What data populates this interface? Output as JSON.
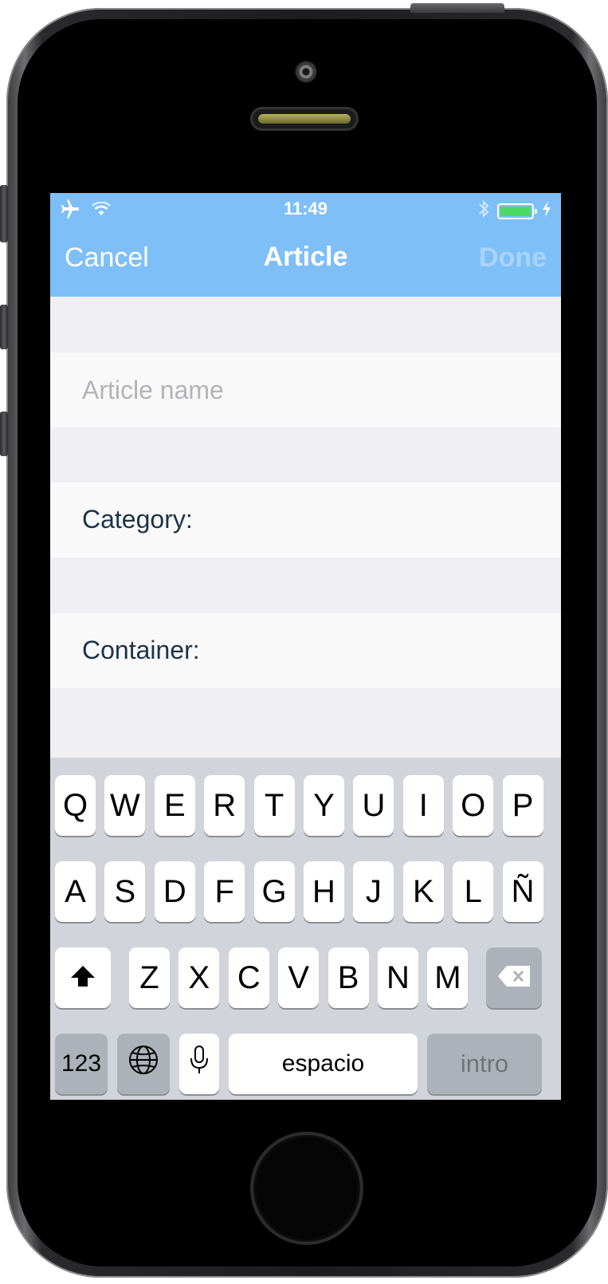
{
  "status_bar": {
    "time": "11:49",
    "battery_color": "#4cd964",
    "left_icons": [
      "airplane-icon",
      "wifi-icon"
    ],
    "right_icons": [
      "bluetooth-icon",
      "battery-icon",
      "charging-bolt-icon"
    ]
  },
  "nav": {
    "cancel_label": "Cancel",
    "title": "Article",
    "done_label": "Done",
    "bar_color": "#7fbff8"
  },
  "form": {
    "name_placeholder": "Article name",
    "name_value": "",
    "category_label": "Category:",
    "container_label": "Container:"
  },
  "keyboard": {
    "row1": [
      "Q",
      "W",
      "E",
      "R",
      "T",
      "Y",
      "U",
      "I",
      "O",
      "P"
    ],
    "row2": [
      "A",
      "S",
      "D",
      "F",
      "G",
      "H",
      "J",
      "K",
      "L",
      "Ñ"
    ],
    "row3": [
      "Z",
      "X",
      "C",
      "V",
      "B",
      "N",
      "M"
    ],
    "numbers_label": "123",
    "space_label": "espacio",
    "return_label": "intro",
    "icons": [
      "shift-icon",
      "backspace-icon",
      "globe-icon",
      "microphone-icon"
    ]
  }
}
